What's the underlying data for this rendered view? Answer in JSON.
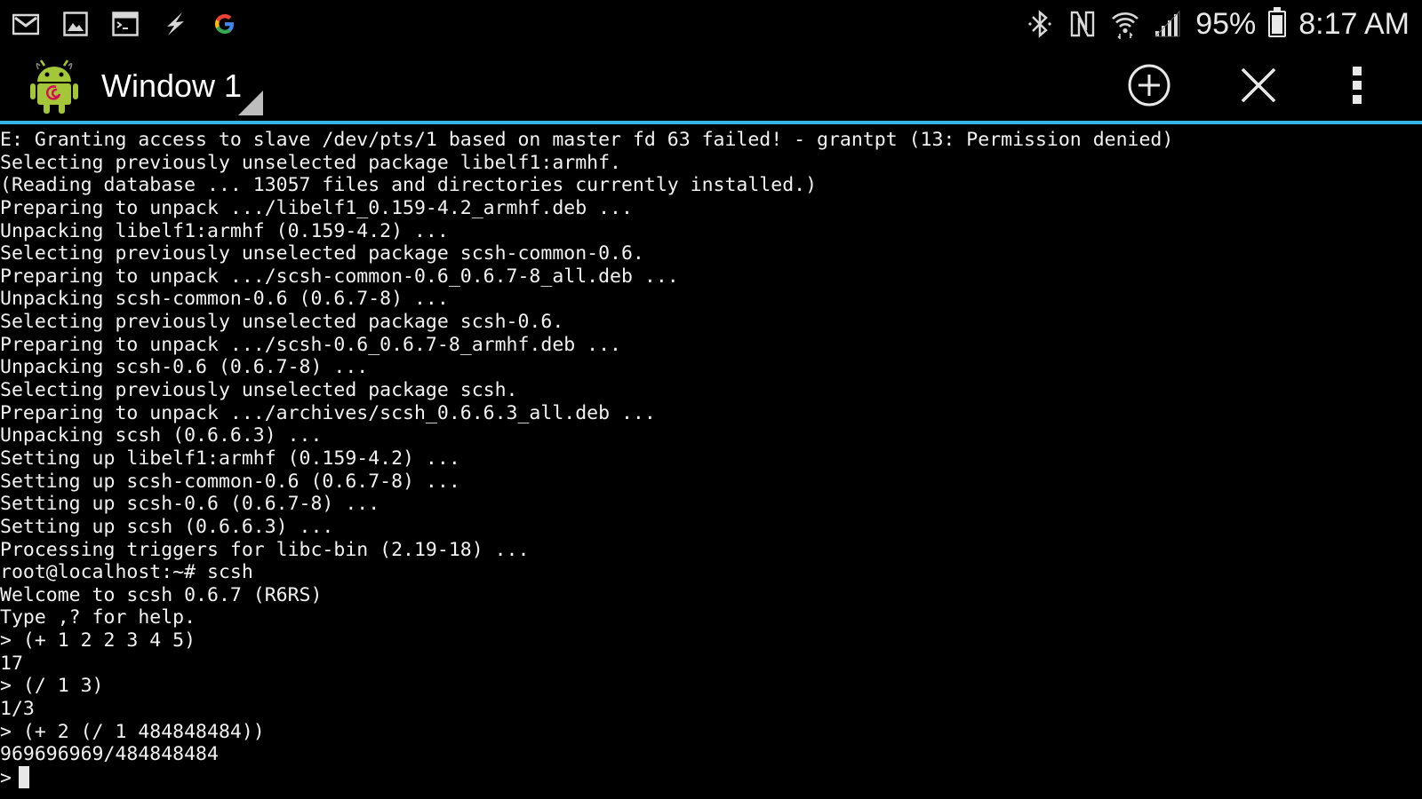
{
  "status_bar": {
    "notification_icons": [
      "gmail-icon",
      "gallery-icon",
      "terminal-icon",
      "flash-icon",
      "google-icon"
    ],
    "system_icons": [
      "bluetooth-icon",
      "nfc-icon",
      "wifi-icon",
      "signal-icon"
    ],
    "battery_percent": "95%",
    "battery_level": 0.95,
    "time": "8:17 AM"
  },
  "action_bar": {
    "app_icon": "android-debian-icon",
    "window_title": "Window 1",
    "actions": [
      "new-window-icon",
      "close-window-icon",
      "overflow-menu-icon"
    ]
  },
  "colors": {
    "background": "#000000",
    "text": "#f2f2f2",
    "accent": "#34b5e5"
  },
  "terminal": {
    "lines": [
      "E: Granting access to slave /dev/pts/1 based on master fd 63 failed! - grantpt (13: Permission denied)",
      "Selecting previously unselected package libelf1:armhf.",
      "(Reading database ... 13057 files and directories currently installed.)",
      "Preparing to unpack .../libelf1_0.159-4.2_armhf.deb ...",
      "Unpacking libelf1:armhf (0.159-4.2) ...",
      "Selecting previously unselected package scsh-common-0.6.",
      "Preparing to unpack .../scsh-common-0.6_0.6.7-8_all.deb ...",
      "Unpacking scsh-common-0.6 (0.6.7-8) ...",
      "Selecting previously unselected package scsh-0.6.",
      "Preparing to unpack .../scsh-0.6_0.6.7-8_armhf.deb ...",
      "Unpacking scsh-0.6 (0.6.7-8) ...",
      "Selecting previously unselected package scsh.",
      "Preparing to unpack .../archives/scsh_0.6.6.3_all.deb ...",
      "Unpacking scsh (0.6.6.3) ...",
      "Setting up libelf1:armhf (0.159-4.2) ...",
      "Setting up scsh-common-0.6 (0.6.7-8) ...",
      "Setting up scsh-0.6 (0.6.7-8) ...",
      "Setting up scsh (0.6.6.3) ...",
      "Processing triggers for libc-bin (2.19-18) ...",
      "root@localhost:~# scsh",
      "Welcome to scsh 0.6.7 (R6RS)",
      "Type ,? for help.",
      "> (+ 1 2 2 3 4 5)",
      "17",
      "> (/ 1 3)",
      "1/3",
      "> (+ 2 (/ 1 484848484))",
      "969696969/484848484"
    ],
    "prompt": ">"
  }
}
